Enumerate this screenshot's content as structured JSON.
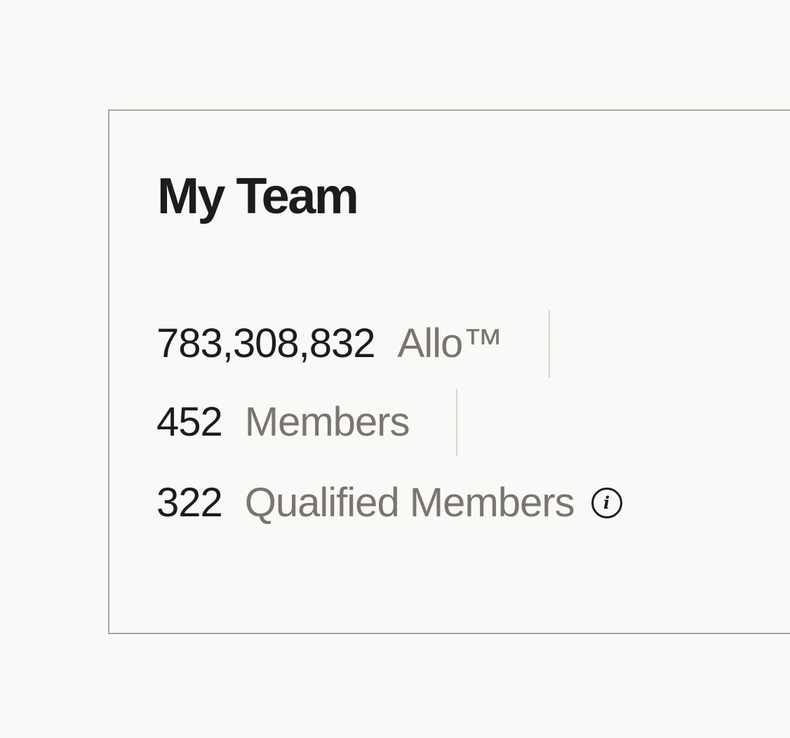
{
  "team_card": {
    "title": "My Team",
    "stats": [
      {
        "value": "783,308,832",
        "label": "Allo™"
      },
      {
        "value": "452",
        "label": "Members"
      },
      {
        "value": "322",
        "label": "Qualified Members"
      }
    ],
    "info_icon": "info-icon",
    "colors": {
      "text_primary": "#1e1c1b",
      "text_secondary": "#7b7570",
      "border": "#aaa6a2",
      "divider": "#d8d6d3",
      "background": "#f9f9f8"
    }
  }
}
